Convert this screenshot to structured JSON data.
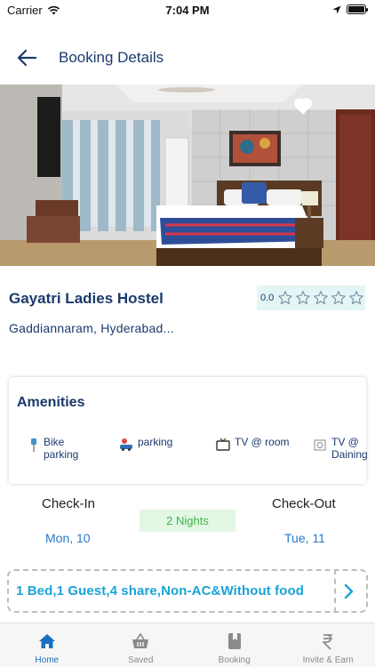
{
  "status_bar": {
    "carrier": "Carrier",
    "time": "7:04 PM"
  },
  "header": {
    "title": "Booking Details"
  },
  "hotel": {
    "name": "Gayatri Ladies Hostel",
    "rating": "0.0",
    "stars_filled": 0,
    "stars_total": 5,
    "location": "Gaddiannaram, Hyderabad..."
  },
  "amenities": {
    "title": "Amenities",
    "items": [
      {
        "label": "Bike\nparking",
        "icon": "bike-parking-icon"
      },
      {
        "label": "parking",
        "icon": "car-parking-icon"
      },
      {
        "label": "TV @ room",
        "icon": "tv-icon"
      },
      {
        "label": "TV @\nDaining",
        "icon": "tv-dining-icon"
      }
    ]
  },
  "stay": {
    "checkin_label": "Check-In",
    "checkin_date": "Mon, 10",
    "checkout_label": "Check-Out",
    "checkout_date": "Tue, 11",
    "nights": "2 Nights"
  },
  "room": {
    "description": "1 Bed,1 Guest,4 share,Non-AC&Without food"
  },
  "tabs": [
    {
      "label": "Home",
      "icon": "home-icon",
      "active": true
    },
    {
      "label": "Saved",
      "icon": "basket-icon",
      "active": false
    },
    {
      "label": "Booking",
      "icon": "book-icon",
      "active": false
    },
    {
      "label": "Invite & Earn",
      "icon": "rupee-icon",
      "active": false
    }
  ],
  "colors": {
    "primary_text": "#1c3a6b",
    "link_blue": "#2878c8",
    "nights_green": "#3cb44b",
    "room_text": "#1aa3d9",
    "active_tab": "#1a6fc2"
  }
}
